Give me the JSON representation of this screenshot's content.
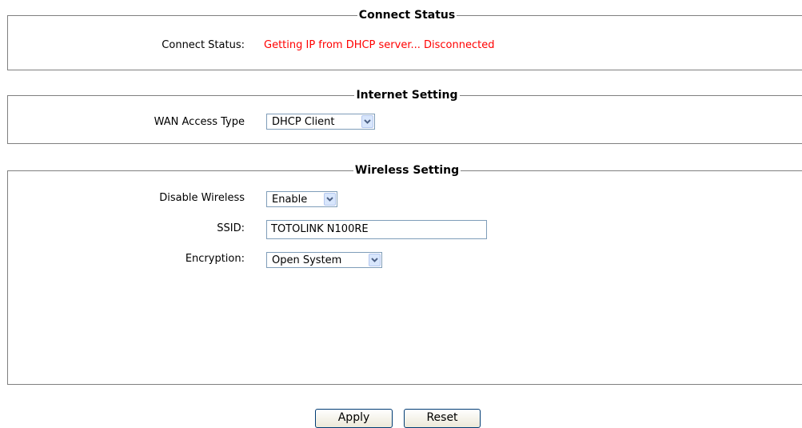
{
  "connect_status": {
    "legend": "Connect Status",
    "label": "Connect Status:",
    "value": "Getting IP from DHCP server... Disconnected",
    "value_color": "#ff0000"
  },
  "internet_setting": {
    "legend": "Internet Setting",
    "wan_label": "WAN Access Type",
    "wan_value": "DHCP Client"
  },
  "wireless_setting": {
    "legend": "Wireless Setting",
    "disable_label": "Disable Wireless",
    "disable_value": "Enable",
    "ssid_label": "SSID:",
    "ssid_value": "TOTOLINK N100RE",
    "encryption_label": "Encryption:",
    "encryption_value": "Open System"
  },
  "buttons": {
    "apply": "Apply",
    "reset": "Reset"
  },
  "icons": {
    "dropdown": "chevron-down-icon"
  }
}
